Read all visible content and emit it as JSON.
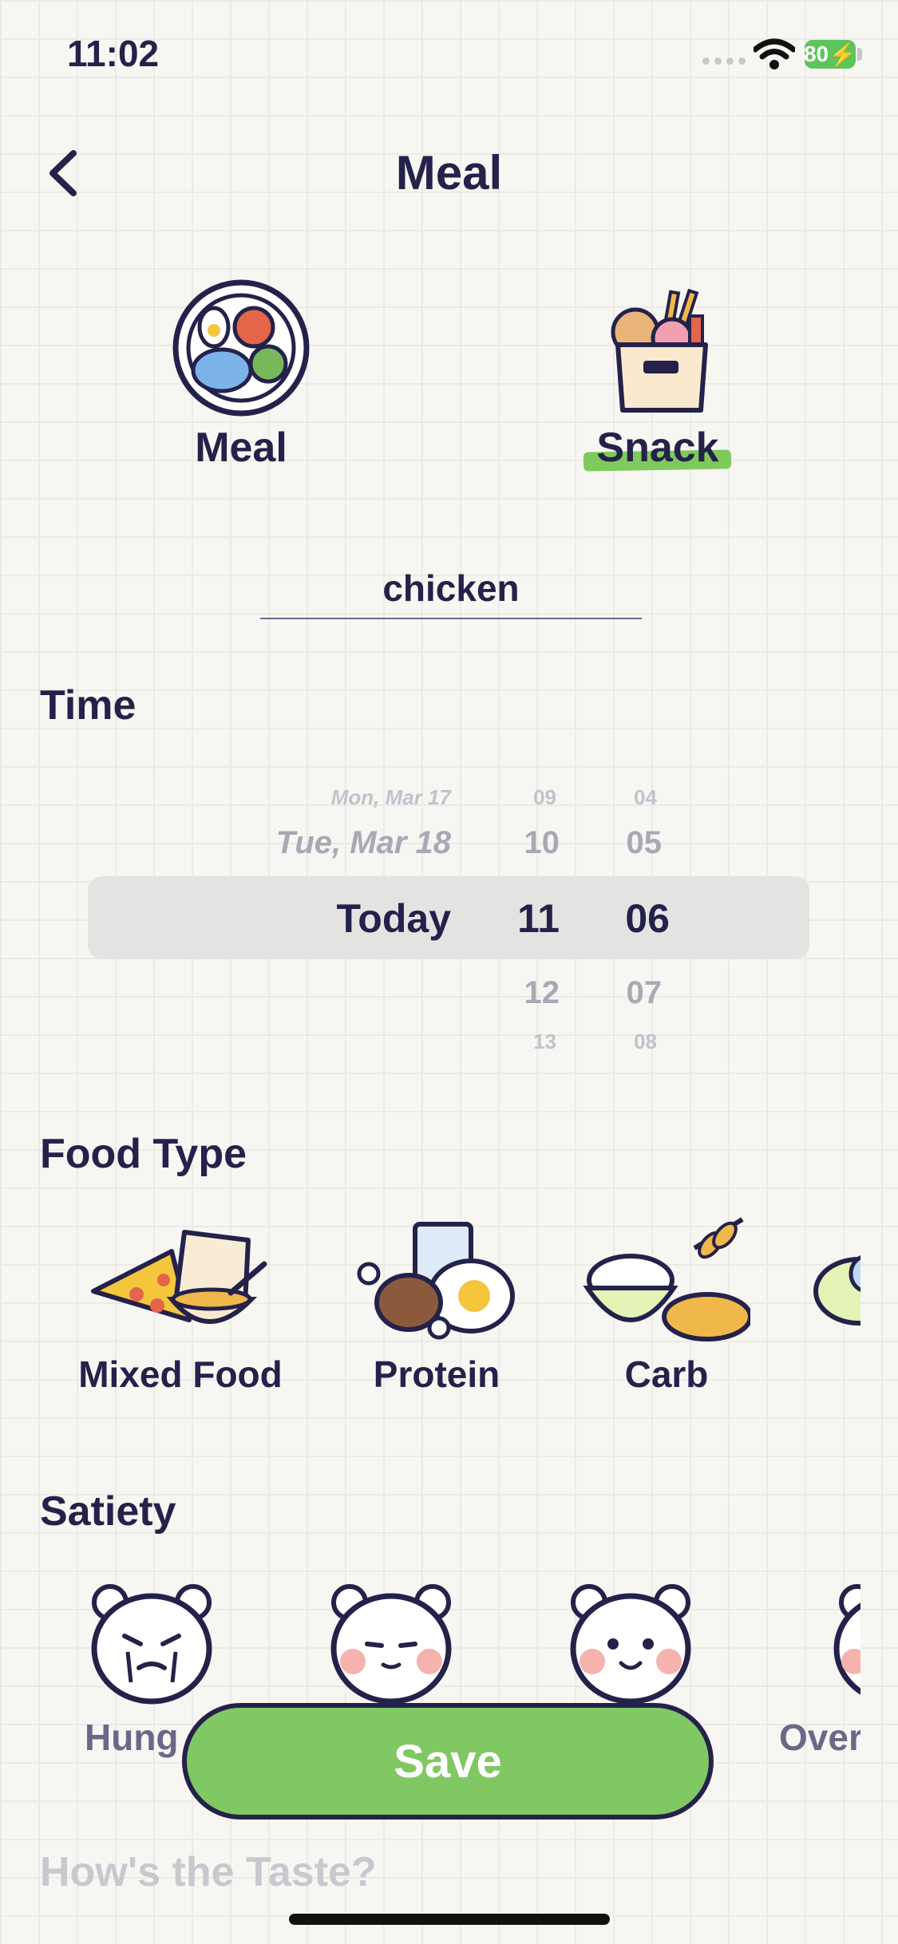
{
  "status_bar": {
    "time": "11:02",
    "battery": "80"
  },
  "header": {
    "title": "Meal",
    "back_icon": "chevron-left-icon"
  },
  "meal_types": [
    {
      "label": "Meal",
      "icon": "meal-plate-icon",
      "selected": false
    },
    {
      "label": "Snack",
      "icon": "snack-box-icon",
      "selected": true
    }
  ],
  "name_field": {
    "value": "chicken"
  },
  "time_section": {
    "title": "Time",
    "picker": {
      "dates": [
        "Mon, Mar 17",
        "Tue, Mar 18",
        "Today"
      ],
      "hours": [
        "09",
        "10",
        "11",
        "12",
        "13"
      ],
      "minutes": [
        "04",
        "05",
        "06",
        "07",
        "08"
      ],
      "selected": {
        "date": "Today",
        "hour": "11",
        "minute": "06"
      }
    }
  },
  "food_type_section": {
    "title": "Food Type",
    "items": [
      {
        "label": "Mixed Food",
        "icon": "mixed-food-icon"
      },
      {
        "label": "Protein",
        "icon": "protein-icon"
      },
      {
        "label": "Carb",
        "icon": "carb-icon"
      }
    ]
  },
  "satiety_section": {
    "title": "Satiety",
    "items": [
      {
        "label": "Hung",
        "icon": "hungry-bear-icon"
      },
      {
        "label": "",
        "icon": "neutral-bear-icon"
      },
      {
        "label": "",
        "icon": "happy-bear-icon"
      },
      {
        "label": "Over",
        "icon": "over-bear-icon"
      }
    ]
  },
  "save_label": "Save",
  "taste_section": {
    "title": "How's the Taste?"
  },
  "colors": {
    "accent_green": "#80c863",
    "ink": "#24224a",
    "background": "#f7f6f3"
  }
}
